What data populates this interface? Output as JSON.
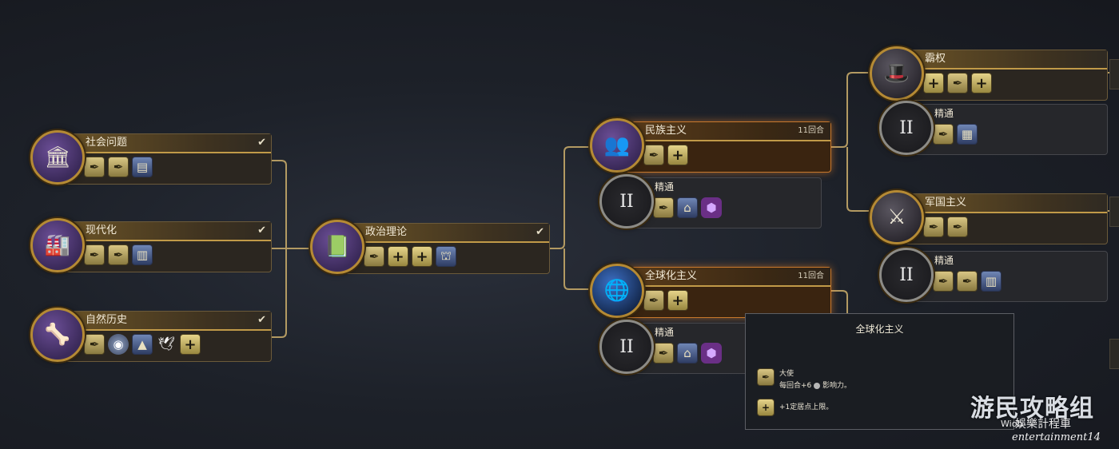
{
  "nodes": {
    "social_issues": {
      "title": "社会问题",
      "check": "✔"
    },
    "modernization": {
      "title": "现代化",
      "check": "✔"
    },
    "natural_history": {
      "title": "自然历史",
      "check": "✔"
    },
    "political_theory": {
      "title": "政治理论",
      "check": "✔"
    },
    "nationalism": {
      "title": "民族主义",
      "turns": "11回合"
    },
    "nationalism_mastery": {
      "title": "精通",
      "numeral": "II"
    },
    "globalism": {
      "title": "全球化主义",
      "turns": "11回合"
    },
    "globalism_mastery": {
      "title": "精通",
      "numeral": "II"
    },
    "hegemony": {
      "title": "霸权"
    },
    "hegemony_mastery": {
      "title": "精通",
      "numeral": "II"
    },
    "militarism": {
      "title": "军国主义"
    },
    "militarism_mastery": {
      "title": "精通",
      "numeral": "II"
    }
  },
  "tooltip": {
    "title": "全球化主义",
    "effect1_name": "大使",
    "effect1_desc_prefix": "每回合+6",
    "effect1_desc_suffix": "影响力。",
    "effect2_desc": "+1定居点上限。"
  },
  "watermark": {
    "main": "游民攻略组",
    "sub": "娛樂計程車",
    "small": "Wiob",
    "script": "entertainment14"
  },
  "icons": {
    "feather": "✒",
    "plus": "+",
    "check": "✔",
    "numeral_style": "roman"
  },
  "colors": {
    "accent_gold": "#c19a48",
    "active_glow": "#e6822a",
    "medallion_purple": "#6b4e96"
  }
}
